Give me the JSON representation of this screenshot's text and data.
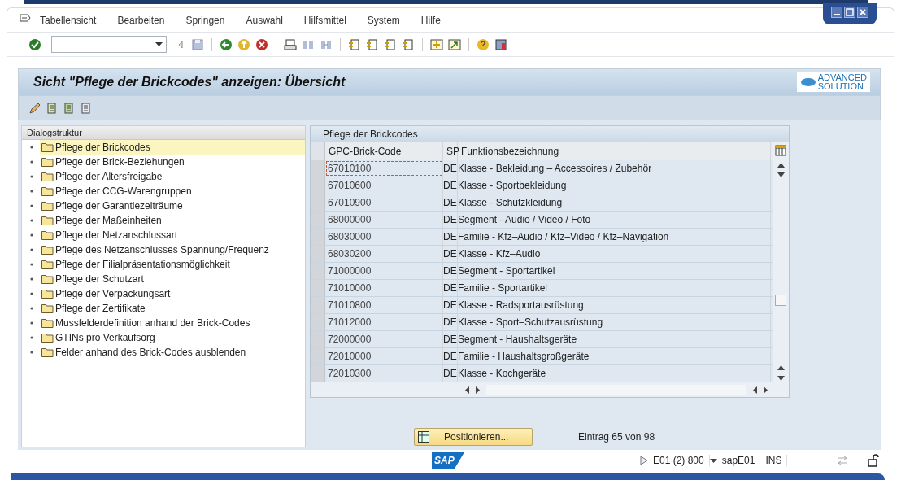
{
  "menu": [
    {
      "label": "Tabellensicht"
    },
    {
      "label": "Bearbeiten"
    },
    {
      "label": "Springen"
    },
    {
      "label": "Auswahl"
    },
    {
      "label": "Hilfsmittel"
    },
    {
      "label": "System"
    },
    {
      "label": "Hilfe"
    }
  ],
  "title": "Sicht \"Pflege der Brickcodes\" anzeigen: Übersicht",
  "logo": {
    "line_1": "ADVANCED",
    "line_2": "SOLUTION"
  },
  "tree": {
    "header": "Dialogstruktur",
    "items": [
      {
        "label": "Pflege der Brickcodes",
        "selected": true
      },
      {
        "label": "Pflege der Brick-Beziehungen",
        "selected": false
      },
      {
        "label": "Pflege der Altersfreigabe",
        "selected": false
      },
      {
        "label": "Pflege der CCG-Warengruppen",
        "selected": false
      },
      {
        "label": "Pflege der Garantiezeiträume",
        "selected": false
      },
      {
        "label": "Pflege der Maßeinheiten",
        "selected": false
      },
      {
        "label": "Pflege der Netzanschlussart",
        "selected": false
      },
      {
        "label": "Pflege des Netzanschlusses Spannung/Frequenz",
        "selected": false
      },
      {
        "label": "Pflege der Filialpräsentationsmöglichkeit",
        "selected": false
      },
      {
        "label": "Pflege der Schutzart",
        "selected": false
      },
      {
        "label": "Pflege der Verpackungsart",
        "selected": false
      },
      {
        "label": "Pflege der Zertifikate",
        "selected": false
      },
      {
        "label": "Mussfelderdefinition anhand der Brick-Codes",
        "selected": false
      },
      {
        "label": "GTINs pro Verkaufsorg",
        "selected": false
      },
      {
        "label": "Felder anhand des Brick-Codes ausblenden",
        "selected": false
      }
    ]
  },
  "table": {
    "title": "Pflege der Brickcodes",
    "columns": [
      "GPC-Brick-Code",
      "SP",
      "Funktionsbezeichnung"
    ],
    "rows": [
      {
        "code": "67010100",
        "sp": "DE",
        "name": "Klasse - Bekleidung – Accessoires / Zubehör",
        "focused": true
      },
      {
        "code": "67010600",
        "sp": "DE",
        "name": "Klasse - Sportbekleidung",
        "focused": false
      },
      {
        "code": "67010900",
        "sp": "DE",
        "name": "Klasse - Schutzkleidung",
        "focused": false
      },
      {
        "code": "68000000",
        "sp": "DE",
        "name": "Segment - Audio / Video / Foto",
        "focused": false
      },
      {
        "code": "68030000",
        "sp": "DE",
        "name": "Familie - Kfz–Audio / Kfz–Video / Kfz–Navigation",
        "focused": false
      },
      {
        "code": "68030200",
        "sp": "DE",
        "name": "Klasse - Kfz–Audio",
        "focused": false
      },
      {
        "code": "71000000",
        "sp": "DE",
        "name": "Segment - Sportartikel",
        "focused": false
      },
      {
        "code": "71010000",
        "sp": "DE",
        "name": "Familie - Sportartikel",
        "focused": false
      },
      {
        "code": "71010800",
        "sp": "DE",
        "name": "Klasse - Radsportausrüstung",
        "focused": false
      },
      {
        "code": "71012000",
        "sp": "DE",
        "name": "Klasse - Sport–Schutzausrüstung",
        "focused": false
      },
      {
        "code": "72000000",
        "sp": "DE",
        "name": "Segment - Haushaltsgeräte",
        "focused": false
      },
      {
        "code": "72010000",
        "sp": "DE",
        "name": "Familie - Haushaltsgroßgeräte",
        "focused": false
      },
      {
        "code": "72010300",
        "sp": "DE",
        "name": "Klasse - Kochgeräte",
        "focused": false
      }
    ]
  },
  "position_button": "Positionieren...",
  "entry_info": "Eintrag 65 von 98",
  "status_bar": {
    "logo": "SAP",
    "system": "E01 (2) 800",
    "server": "sapE01",
    "mode": "INS"
  }
}
